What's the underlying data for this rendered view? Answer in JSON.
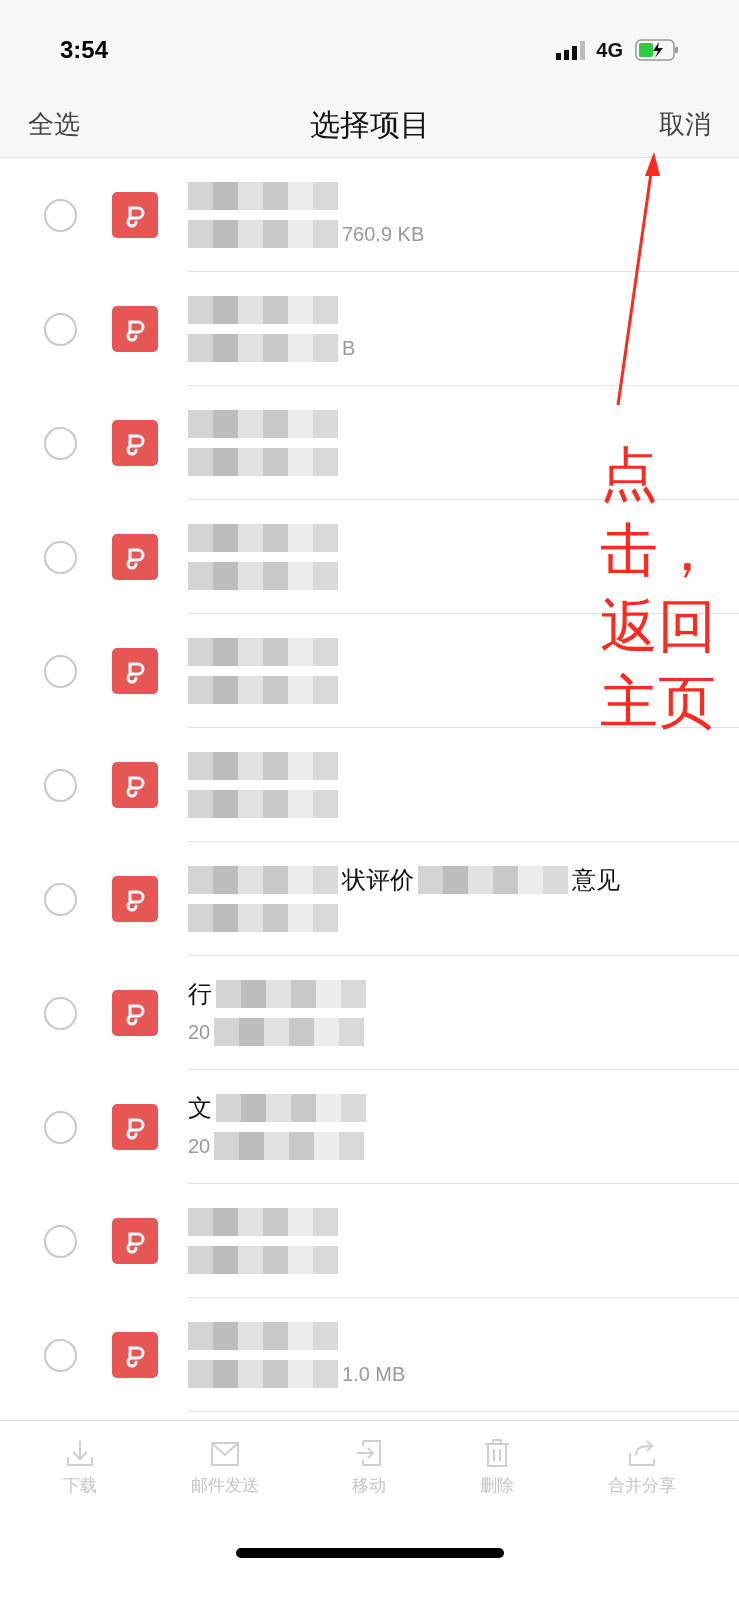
{
  "status_bar": {
    "time": "3:54",
    "network": "4G"
  },
  "nav": {
    "left": "全选",
    "title": "选择项目",
    "right": "取消"
  },
  "rows": [
    {
      "selected": false,
      "title": [
        {
          "kind": "blur"
        }
      ],
      "subtitle": [
        {
          "kind": "blur"
        },
        {
          "kind": "text",
          "text": "760.9 KB"
        }
      ]
    },
    {
      "selected": false,
      "title": [
        {
          "kind": "blur"
        }
      ],
      "subtitle": [
        {
          "kind": "blur"
        },
        {
          "kind": "text",
          "text": "B"
        }
      ]
    },
    {
      "selected": false,
      "title": [
        {
          "kind": "blur"
        }
      ],
      "subtitle": [
        {
          "kind": "blur"
        }
      ]
    },
    {
      "selected": false,
      "title": [
        {
          "kind": "blur"
        }
      ],
      "subtitle": [
        {
          "kind": "blur"
        }
      ]
    },
    {
      "selected": false,
      "title": [
        {
          "kind": "blur"
        }
      ],
      "subtitle": [
        {
          "kind": "blur"
        }
      ]
    },
    {
      "selected": false,
      "title": [
        {
          "kind": "blur"
        }
      ],
      "subtitle": [
        {
          "kind": "blur"
        }
      ]
    },
    {
      "selected": false,
      "title": [
        {
          "kind": "blur"
        },
        {
          "kind": "text",
          "text": "状评价"
        },
        {
          "kind": "blur"
        },
        {
          "kind": "text",
          "text": "意见"
        }
      ],
      "subtitle": [
        {
          "kind": "blur"
        }
      ]
    },
    {
      "selected": false,
      "title": [
        {
          "kind": "text",
          "text": "行"
        },
        {
          "kind": "blur"
        }
      ],
      "subtitle": [
        {
          "kind": "text",
          "text": "20"
        },
        {
          "kind": "blur"
        }
      ]
    },
    {
      "selected": false,
      "title": [
        {
          "kind": "text",
          "text": "文"
        },
        {
          "kind": "blur"
        }
      ],
      "subtitle": [
        {
          "kind": "text",
          "text": "20"
        },
        {
          "kind": "blur"
        }
      ]
    },
    {
      "selected": false,
      "title": [
        {
          "kind": "blur"
        }
      ],
      "subtitle": [
        {
          "kind": "blur"
        }
      ]
    },
    {
      "selected": false,
      "title": [
        {
          "kind": "blur"
        }
      ],
      "subtitle": [
        {
          "kind": "blur"
        },
        {
          "kind": "text",
          "text": "1.0 MB"
        }
      ]
    }
  ],
  "toolbar": [
    {
      "kind": "download",
      "label": "下载",
      "disabled": true
    },
    {
      "kind": "mail",
      "label": "邮件发送",
      "disabled": true
    },
    {
      "kind": "move",
      "label": "移动",
      "disabled": true
    },
    {
      "kind": "delete",
      "label": "删除",
      "disabled": true
    },
    {
      "kind": "share",
      "label": "合并分享",
      "disabled": true
    }
  ],
  "annotation": {
    "lines": [
      "点",
      "击，",
      "返回",
      "主页"
    ]
  }
}
